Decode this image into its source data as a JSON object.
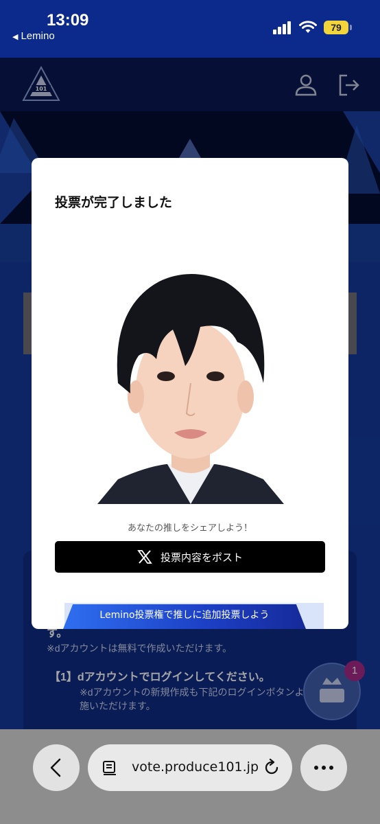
{
  "status_bar": {
    "time": "13:09",
    "back_app": "Lemino",
    "battery": "79",
    "battery_color": "#f2d43b"
  },
  "site": {
    "logo_text": "PRODUCE 101",
    "accent": "#0c2a8c"
  },
  "background": {
    "line1": "す。",
    "note": "※dアカウントは無料で作成いただけます。",
    "step1": "【1】dアカウントでログインしてください。",
    "note2": "※dアカウントの新規作成も下記のログインボタンよ",
    "note3": "施いただけます。",
    "vote_badge": "1"
  },
  "modal": {
    "title": "投票が完了しました",
    "share_caption": "あなたの推しをシェアしよう！",
    "post_label": "投票内容をポスト",
    "lemino_banner": "Lemino投票権で推しに追加投票しよう"
  },
  "browser": {
    "url": "vote.produce101.jp"
  },
  "icons": {
    "back": "chevron-left-icon",
    "more": "ellipsis-icon",
    "reload": "reload-icon",
    "reader": "reader-icon",
    "user": "user-icon",
    "logout": "logout-icon",
    "x": "x-logo-icon"
  }
}
